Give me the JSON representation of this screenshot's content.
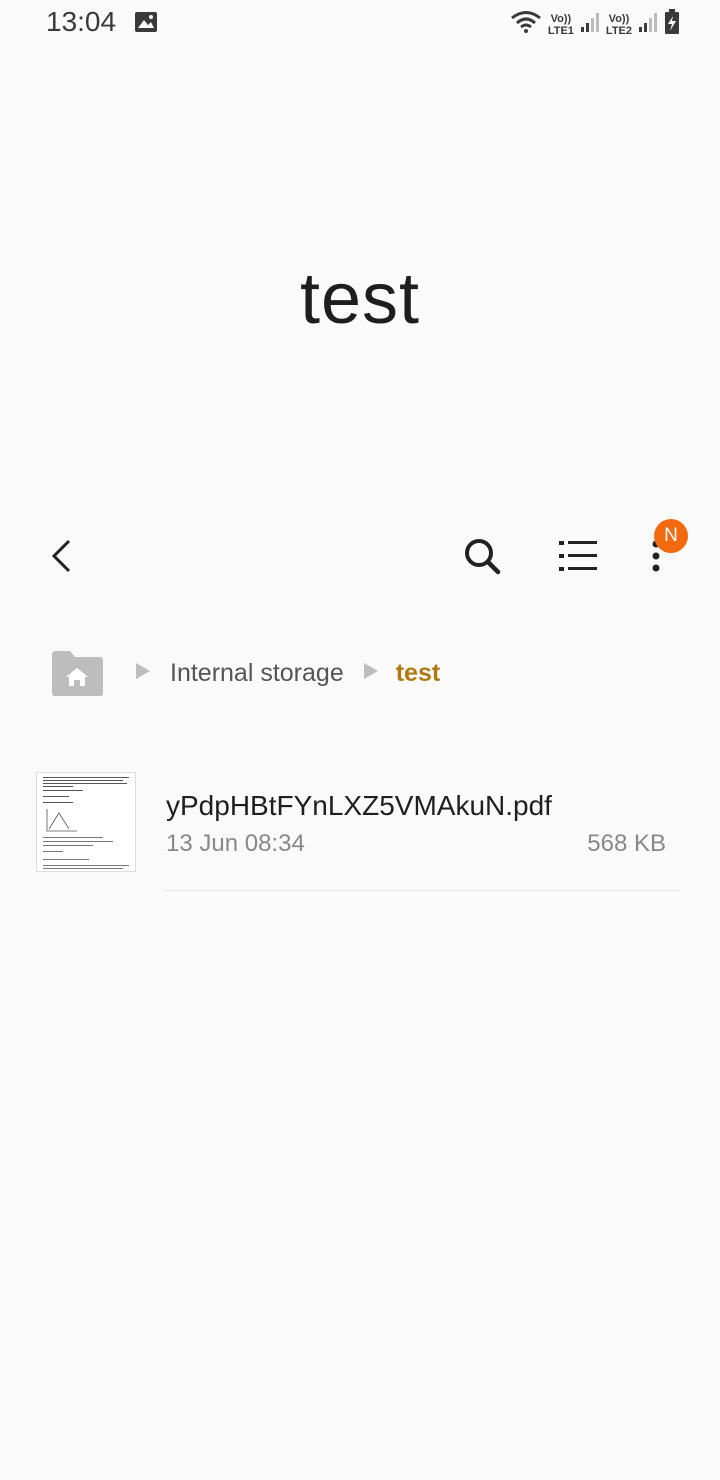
{
  "status_bar": {
    "time": "13:04",
    "sim1_label": "LTE1",
    "sim2_label": "LTE2",
    "volte_label": "Vo))"
  },
  "folder": {
    "title": "test"
  },
  "toolbar": {
    "notification_badge": "N"
  },
  "breadcrumb": {
    "items": [
      "Internal storage",
      "test"
    ]
  },
  "files": [
    {
      "name": "yPdpHBtFYnLXZ5VMAkuN.pdf",
      "date": "13 Jun 08:34",
      "size": "568 KB"
    }
  ],
  "colors": {
    "accent": "#b07a12",
    "badge": "#f26a10"
  }
}
